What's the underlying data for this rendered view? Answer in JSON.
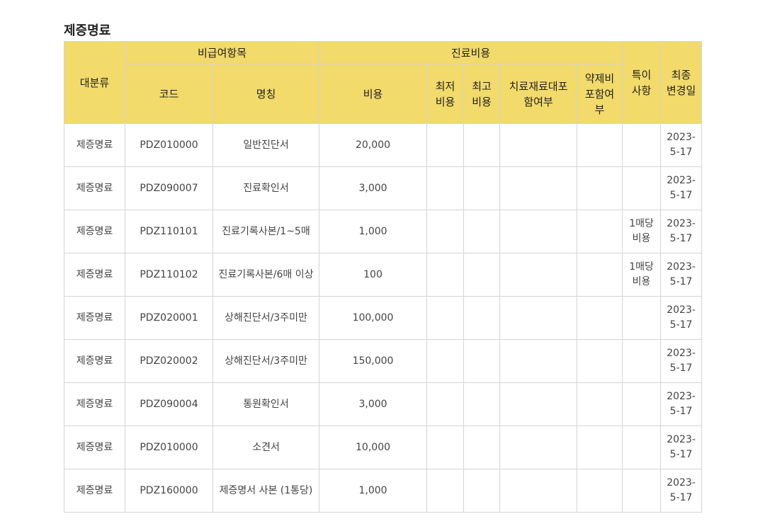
{
  "section_title": "제증명료",
  "headers": {
    "category": "대분류",
    "nonbenefit_group": "비급여항목",
    "cost_group": "진료비용",
    "code": "코드",
    "name": "명칭",
    "cost": "비용",
    "min_cost_l1": "최저",
    "min_cost_l2": "비용",
    "max_cost_l1": "최고",
    "max_cost_l2": "비용",
    "material_l1": "치료재료대포",
    "material_l2": "함여부",
    "drug_l1": "약제비",
    "drug_l2": "포함여",
    "drug_l3": "부",
    "note_l1": "특이",
    "note_l2": "사항",
    "changed_l1": "최종",
    "changed_l2": "변경일"
  },
  "rows": [
    {
      "category": "제증명료",
      "code": "PDZ010000",
      "name": "일반진단서",
      "cost": "20,000",
      "min": "",
      "max": "",
      "material": "",
      "drug": "",
      "note_l1": "",
      "note_l2": "",
      "date_l1": "2023-",
      "date_l2": "5-17"
    },
    {
      "category": "제증명료",
      "code": "PDZ090007",
      "name": "진료확인서",
      "cost": "3,000",
      "min": "",
      "max": "",
      "material": "",
      "drug": "",
      "note_l1": "",
      "note_l2": "",
      "date_l1": "2023-",
      "date_l2": "5-17"
    },
    {
      "category": "제증명료",
      "code": "PDZ110101",
      "name": "진료기록사본/1~5매",
      "cost": "1,000",
      "min": "",
      "max": "",
      "material": "",
      "drug": "",
      "note_l1": "1매당",
      "note_l2": "비용",
      "date_l1": "2023-",
      "date_l2": "5-17"
    },
    {
      "category": "제증명료",
      "code": "PDZ110102",
      "name": "진료기록사본/6매 이상",
      "cost": "100",
      "min": "",
      "max": "",
      "material": "",
      "drug": "",
      "note_l1": "1매당",
      "note_l2": "비용",
      "date_l1": "2023-",
      "date_l2": "5-17"
    },
    {
      "category": "제증명료",
      "code": "PDZ020001",
      "name": "상해진단서/3주미만",
      "cost": "100,000",
      "min": "",
      "max": "",
      "material": "",
      "drug": "",
      "note_l1": "",
      "note_l2": "",
      "date_l1": "2023-",
      "date_l2": "5-17"
    },
    {
      "category": "제증명료",
      "code": "PDZ020002",
      "name": "상해진단서/3주미만",
      "cost": "150,000",
      "min": "",
      "max": "",
      "material": "",
      "drug": "",
      "note_l1": "",
      "note_l2": "",
      "date_l1": "2023-",
      "date_l2": "5-17"
    },
    {
      "category": "제증명료",
      "code": "PDZ090004",
      "name": "통원확인서",
      "cost": "3,000",
      "min": "",
      "max": "",
      "material": "",
      "drug": "",
      "note_l1": "",
      "note_l2": "",
      "date_l1": "2023-",
      "date_l2": "5-17"
    },
    {
      "category": "제증명료",
      "code": "PDZ010000",
      "name": "소견서",
      "cost": "10,000",
      "min": "",
      "max": "",
      "material": "",
      "drug": "",
      "note_l1": "",
      "note_l2": "",
      "date_l1": "2023-",
      "date_l2": "5-17"
    },
    {
      "category": "제증명료",
      "code": "PDZ160000",
      "name": "제증명서 사본 (1통당)",
      "cost": "1,000",
      "min": "",
      "max": "",
      "material": "",
      "drug": "",
      "note_l1": "",
      "note_l2": "",
      "date_l1": "2023-",
      "date_l2": "5-17"
    }
  ],
  "colors": {
    "header_bg": "#f2da6b",
    "border": "#d4d4d4",
    "text": "#444444"
  }
}
